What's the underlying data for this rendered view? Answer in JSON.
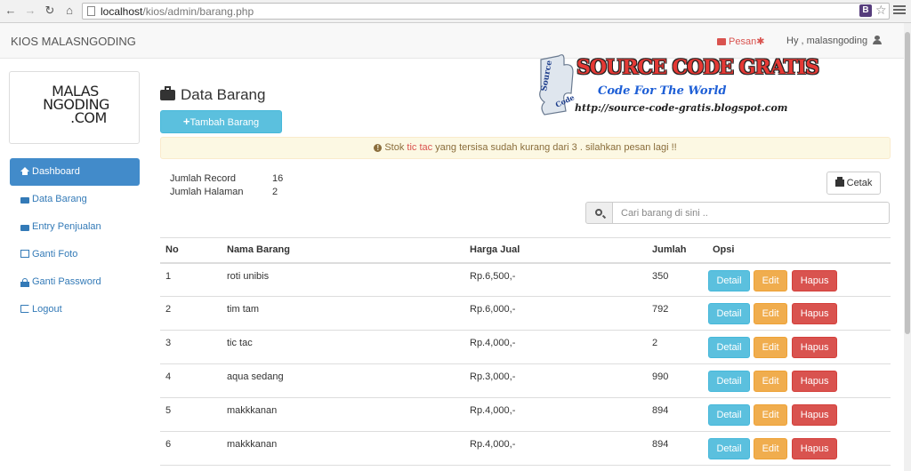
{
  "browser": {
    "url_host": "localhost",
    "url_path": "/kios/admin/barang.php",
    "extension_label": "B"
  },
  "header": {
    "brand": "KIOS MALASNGODING",
    "pesan_label": "Pesan",
    "pesan_badge": "✱",
    "greeting": "Hy , malasngoding"
  },
  "logo": {
    "line1": "MALAS",
    "line2": "NGODING",
    "line3": ".COM"
  },
  "sidebar": {
    "items": [
      {
        "label": "Dashboard",
        "icon": "home-icon"
      },
      {
        "label": "Data Barang",
        "icon": "briefcase-icon"
      },
      {
        "label": "Entry Penjualan",
        "icon": "briefcase-icon"
      },
      {
        "label": "Ganti Foto",
        "icon": "picture-icon"
      },
      {
        "label": "Ganti Password",
        "icon": "lock-icon"
      },
      {
        "label": "Logout",
        "icon": "logout-icon"
      }
    ]
  },
  "watermark": {
    "title": "SOURCE CODE GRATIS",
    "subtitle": "Code For The World",
    "url": "http://source-code-gratis.blogspot.com",
    "puzzle_word1": "Source",
    "puzzle_word2": "Code"
  },
  "main": {
    "title": "Data Barang",
    "add_button": "Tambah Barang",
    "alert": {
      "prefix": "Stok ",
      "item": "tic tac",
      "suffix": " yang tersisa sudah kurang dari 3 . silahkan pesan lagi !!"
    },
    "stats": {
      "record_label": "Jumlah Record",
      "record_value": "16",
      "pages_label": "Jumlah Halaman",
      "pages_value": "2"
    },
    "print_button": "Cetak",
    "search": {
      "placeholder": "Cari barang di sini .."
    }
  },
  "table": {
    "headers": {
      "no": "No",
      "nama": "Nama Barang",
      "harga": "Harga Jual",
      "jumlah": "Jumlah",
      "opsi": "Opsi"
    },
    "actions": {
      "detail": "Detail",
      "edit": "Edit",
      "hapus": "Hapus"
    },
    "rows": [
      {
        "no": "1",
        "nama": "roti unibis",
        "harga": "Rp.6,500,-",
        "jumlah": "350"
      },
      {
        "no": "2",
        "nama": "tim tam",
        "harga": "Rp.6,000,-",
        "jumlah": "792"
      },
      {
        "no": "3",
        "nama": "tic tac",
        "harga": "Rp.4,000,-",
        "jumlah": "2"
      },
      {
        "no": "4",
        "nama": "aqua sedang",
        "harga": "Rp.3,000,-",
        "jumlah": "990"
      },
      {
        "no": "5",
        "nama": "makkkanan",
        "harga": "Rp.4,000,-",
        "jumlah": "894"
      },
      {
        "no": "6",
        "nama": "makkkanan",
        "harga": "Rp.4,000,-",
        "jumlah": "894"
      }
    ]
  },
  "colors": {
    "primary": "#428bca",
    "info": "#5bc0de",
    "warning": "#f0ad4e",
    "danger": "#d9534f",
    "alert_bg": "#fcf8e3"
  }
}
